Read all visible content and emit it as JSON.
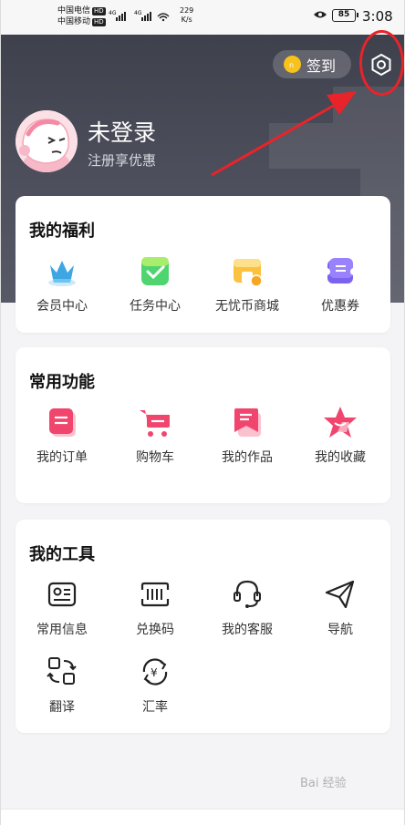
{
  "status_bar": {
    "carrier1": "中国电信",
    "carrier2": "中国移动",
    "hd": "HD",
    "net": "4G",
    "speed_value": "229",
    "speed_unit": "K/s",
    "battery": "85",
    "time": "3:08"
  },
  "header": {
    "sign_in_label": "签到",
    "login_title": "未登录",
    "login_subtitle": "注册享优惠"
  },
  "welfare": {
    "title": "我的福利",
    "items": [
      {
        "label": "会员中心",
        "icon": "crown-icon"
      },
      {
        "label": "任务中心",
        "icon": "task-check-icon"
      },
      {
        "label": "无忧币商城",
        "icon": "coin-store-icon"
      },
      {
        "label": "优惠券",
        "icon": "coupon-icon"
      }
    ]
  },
  "common": {
    "title": "常用功能",
    "items": [
      {
        "label": "我的订单",
        "icon": "order-icon"
      },
      {
        "label": "购物车",
        "icon": "cart-icon"
      },
      {
        "label": "我的作品",
        "icon": "works-icon"
      },
      {
        "label": "我的收藏",
        "icon": "star-icon"
      }
    ]
  },
  "tools": {
    "title": "我的工具",
    "items": [
      {
        "label": "常用信息",
        "icon": "id-card-icon"
      },
      {
        "label": "兑换码",
        "icon": "barcode-icon"
      },
      {
        "label": "我的客服",
        "icon": "headset-icon"
      },
      {
        "label": "导航",
        "icon": "paper-plane-icon"
      },
      {
        "label": "翻译",
        "icon": "translate-icon"
      },
      {
        "label": "汇率",
        "icon": "exchange-rate-icon"
      }
    ]
  },
  "watermark": "Bai 经验",
  "colors": {
    "header_bg": "#45474f",
    "accent_pink": "#f0466e",
    "annotation_red": "#e8242a",
    "coin_yellow": "#f6c21b"
  }
}
